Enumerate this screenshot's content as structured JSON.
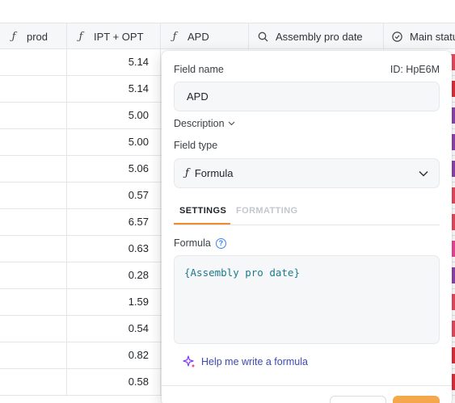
{
  "columns": [
    {
      "icon": "formula-icon",
      "glyph": "ƒ",
      "label": "prod"
    },
    {
      "icon": "formula-icon",
      "glyph": "ƒ",
      "label": "IPT + OPT"
    },
    {
      "icon": "formula-icon",
      "glyph": "ƒ",
      "label": "APD"
    },
    {
      "icon": "lookup-icon",
      "label": "Assembly pro date"
    },
    {
      "icon": "status-icon",
      "label": "Main status"
    }
  ],
  "rows": [
    {
      "ipt_opt": "5.14",
      "status_color": "#e84a5f"
    },
    {
      "ipt_opt": "5.14",
      "status_color": "#e0303b"
    },
    {
      "ipt_opt": "5.00",
      "status_color": "#8e44ad"
    },
    {
      "ipt_opt": "5.00",
      "status_color": "#8e44ad"
    },
    {
      "ipt_opt": "5.06",
      "status_color": "#8e44ad"
    },
    {
      "ipt_opt": "0.57",
      "status_color": "#e84a5f"
    },
    {
      "ipt_opt": "6.57",
      "status_color": "#e84a5f"
    },
    {
      "ipt_opt": "0.63",
      "status_color": "#ec4899"
    },
    {
      "ipt_opt": "0.28",
      "status_color": "#8e44ad"
    },
    {
      "ipt_opt": "1.59",
      "status_color": "#e84a5f"
    },
    {
      "ipt_opt": "0.54",
      "status_color": "#e84a5f"
    },
    {
      "ipt_opt": "0.82",
      "status_color": "#e0303b"
    },
    {
      "ipt_opt": "0.58",
      "status_color": "#e0303b"
    }
  ],
  "popover": {
    "field_name_label": "Field name",
    "field_id": "ID: HpE6M",
    "field_name_value": "APD",
    "description_label": "Description",
    "field_type_label": "Field type",
    "field_type_value": "Formula",
    "field_type_glyph": "ƒ",
    "tabs": [
      {
        "label": "SETTINGS",
        "active": true
      },
      {
        "label": "FORMATTING",
        "active": false
      }
    ],
    "formula_label": "Formula",
    "help_glyph": "?",
    "formula_value": "{Assembly pro date}",
    "ai_link": "Help me write a formula"
  },
  "colors": {
    "accent_tab": "#f08c2b",
    "formula_text": "#1b7a8c",
    "ai_link": "#3b4bb3",
    "primary_button": "#f4a84b"
  }
}
